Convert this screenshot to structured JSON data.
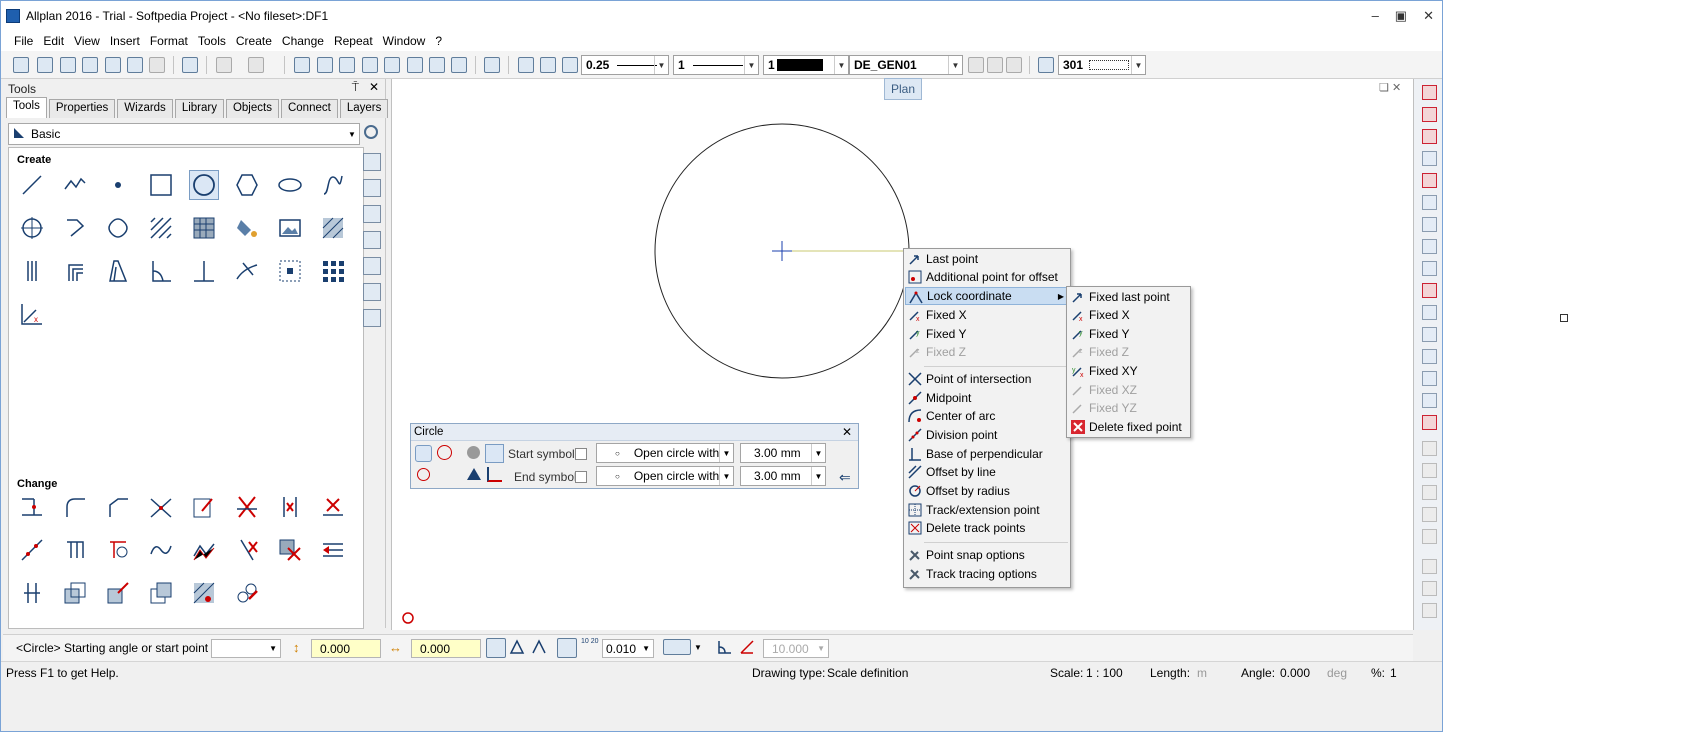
{
  "window": {
    "title": "Allplan 2016 - Trial - Softpedia Project - <No fileset>:DF1",
    "minimize": "–",
    "restore": "▣",
    "close": "✕"
  },
  "menu": [
    "File",
    "Edit",
    "View",
    "Insert",
    "Format",
    "Tools",
    "Create",
    "Change",
    "Repeat",
    "Window",
    "?"
  ],
  "toolbar": {
    "pen": "0.25",
    "line": "1",
    "color": "1",
    "layer": "DE_GEN01",
    "pattern": "301"
  },
  "palette": {
    "title": "Tools",
    "pin": "⍑",
    "close": "✕",
    "tabs": [
      "Tools",
      "Properties",
      "Wizards",
      "Library",
      "Objects",
      "Connect",
      "Layers"
    ],
    "family": "Basic",
    "create_label": "Create",
    "change_label": "Change"
  },
  "canvas": {
    "view_label": "Plan"
  },
  "circle_dialog": {
    "title": "Circle",
    "start_label": "Start symbol",
    "end_label": "End symbol",
    "start_type": "Open circle with",
    "end_type": "Open circle with",
    "start_size": "3.00 mm",
    "end_size": "3.00 mm"
  },
  "context_menu": {
    "items": [
      {
        "label": "Last point",
        "disabled": false
      },
      {
        "label": "Additional point for offset",
        "disabled": false
      },
      {
        "label": "Lock coordinate",
        "disabled": false,
        "highlighted": true
      },
      {
        "label": "Fixed X",
        "disabled": false
      },
      {
        "label": "Fixed Y",
        "disabled": false
      },
      {
        "label": "Fixed Z",
        "disabled": true
      },
      {
        "label": "Point of intersection",
        "disabled": false
      },
      {
        "label": "Midpoint",
        "disabled": false
      },
      {
        "label": "Center of arc",
        "disabled": false
      },
      {
        "label": "Division point",
        "disabled": false
      },
      {
        "label": "Base of perpendicular",
        "disabled": false
      },
      {
        "label": "Offset by line",
        "disabled": false
      },
      {
        "label": "Offset by radius",
        "disabled": false
      },
      {
        "label": "Track/extension point",
        "disabled": false
      },
      {
        "label": "Delete track points",
        "disabled": false
      },
      {
        "label": "Point snap options",
        "disabled": false
      },
      {
        "label": "Track tracing options",
        "disabled": false
      }
    ]
  },
  "submenu": {
    "items": [
      {
        "label": "Fixed last point",
        "disabled": false
      },
      {
        "label": "Fixed X",
        "disabled": false
      },
      {
        "label": "Fixed Y",
        "disabled": false
      },
      {
        "label": "Fixed Z",
        "disabled": true
      },
      {
        "label": "Fixed XY",
        "disabled": false
      },
      {
        "label": "Fixed XZ",
        "disabled": true
      },
      {
        "label": "Fixed YZ",
        "disabled": true
      },
      {
        "label": "Delete fixed point",
        "disabled": false
      }
    ]
  },
  "commandbar": {
    "prompt": "<Circle> Starting angle or start point",
    "x": "0.000",
    "y": "0.000",
    "step": "0.010",
    "angle": "10.000"
  },
  "statusbar": {
    "help": "Press F1 to get Help.",
    "drawing_type_label": "Drawing type:",
    "drawing_type": "Scale definition",
    "scale_label": "Scale:",
    "scale": "1 : 100",
    "length_label": "Length:",
    "length_unit": "m",
    "angle_label": "Angle:",
    "angle": "0.000",
    "angle_unit": "deg",
    "percent_label": "%:",
    "percent": "1"
  },
  "colors": {
    "accent": "#1f5fae",
    "highlight": "#c9ddf2",
    "input_yellow": "#ffffc8",
    "delete_red": "#d8262f"
  }
}
